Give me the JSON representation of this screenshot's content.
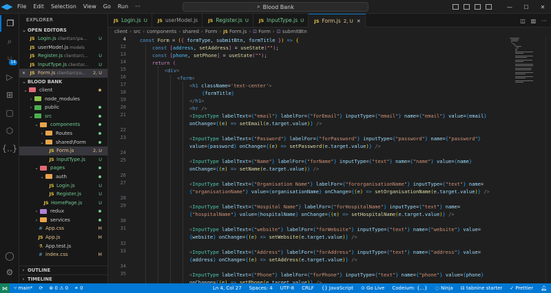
{
  "titlebar": {
    "menu": [
      "File",
      "Edit",
      "Selection",
      "View",
      "Go",
      "Run",
      "···"
    ],
    "search": "Blood Bank"
  },
  "sidebar": {
    "title": "EXPLORER",
    "open_editors_label": "OPEN EDITORS",
    "open_editors": [
      {
        "name": "Login.js",
        "desc": "client\\src\\pa...",
        "status": "U",
        "icon": "JS"
      },
      {
        "name": "userModel.js",
        "desc": "models",
        "status": "",
        "icon": "JS"
      },
      {
        "name": "Register.js",
        "desc": "client\\src\\...",
        "status": "U",
        "icon": "JS"
      },
      {
        "name": "InputType.js",
        "desc": "client\\sr...",
        "status": "U",
        "icon": "JS"
      },
      {
        "name": "Form.js",
        "desc": "client\\src\\co...",
        "status": "2, U",
        "icon": "JS",
        "close": "✕"
      }
    ],
    "project_label": "BLOOD BANK",
    "tree": [
      {
        "name": "client",
        "kind": "folder",
        "depth": 0,
        "open": true,
        "color": "#e06c75"
      },
      {
        "name": "node_modules",
        "kind": "folder",
        "depth": 1,
        "open": false,
        "color": "#8bc34a"
      },
      {
        "name": "public",
        "kind": "folder",
        "depth": 1,
        "open": false,
        "color": "#4caf50"
      },
      {
        "name": "src",
        "kind": "folder",
        "depth": 1,
        "open": true,
        "color": "#4caf50"
      },
      {
        "name": "components",
        "kind": "folder",
        "depth": 2,
        "open": true,
        "color": "#e8a54b"
      },
      {
        "name": "Routes",
        "kind": "folder",
        "depth": 3,
        "open": false,
        "color": "#e8a54b"
      },
      {
        "name": "shared\\Form",
        "kind": "folder",
        "depth": 3,
        "open": true,
        "color": "#e8a54b"
      },
      {
        "name": "Form.js",
        "kind": "js",
        "depth": 4,
        "status": "2, U",
        "selected": true
      },
      {
        "name": "InputType.js",
        "kind": "js",
        "depth": 4,
        "status": "U"
      },
      {
        "name": "pages",
        "kind": "folder",
        "depth": 2,
        "open": true,
        "color": "#e06c75"
      },
      {
        "name": "auth",
        "kind": "folder",
        "depth": 3,
        "open": true,
        "color": "#e8a54b"
      },
      {
        "name": "Login.js",
        "kind": "js",
        "depth": 4,
        "status": "U"
      },
      {
        "name": "Register.js",
        "kind": "js",
        "depth": 4,
        "status": "U"
      },
      {
        "name": "HomePage.js",
        "kind": "js",
        "depth": 3,
        "status": "U"
      },
      {
        "name": "redux",
        "kind": "folder",
        "depth": 2,
        "open": false,
        "color": "#b180d7"
      },
      {
        "name": "services",
        "kind": "folder",
        "depth": 2,
        "open": false,
        "color": "#e8a54b"
      },
      {
        "name": "App.css",
        "kind": "css",
        "depth": 2,
        "status": "M"
      },
      {
        "name": "App.js",
        "kind": "js",
        "depth": 2,
        "status": "M"
      },
      {
        "name": "App.test.js",
        "kind": "test",
        "depth": 2,
        "status": ""
      },
      {
        "name": "index.css",
        "kind": "css",
        "depth": 2,
        "status": "M"
      }
    ],
    "outline_label": "OUTLINE",
    "timeline_label": "TIMELINE"
  },
  "activity": {
    "source_control_badge": "14"
  },
  "tabs": [
    {
      "label": "Login.js",
      "status": "U",
      "active": false
    },
    {
      "label": "userModel.js",
      "status": "",
      "active": false
    },
    {
      "label": "Register.js",
      "status": "U",
      "active": false
    },
    {
      "label": "InputType.js",
      "status": "U",
      "active": false
    },
    {
      "label": "Form.js",
      "status": "2, U",
      "active": true
    }
  ],
  "breadcrumb": [
    "client",
    "src",
    "components",
    "shared",
    "Form",
    "Form.js",
    "Form",
    "submitBtn"
  ],
  "editor": {
    "lines": [
      {
        "n": "4",
        "html": "<span class=\"kw\">const</span> <span class=\"fn\">Form</span> = <span class=\"br1\">(</span><span class=\"br2\">{</span> <span class=\"var\">formType</span>, <span class=\"var\">submitBtn</span>, <span class=\"var\">formTitle</span> <span class=\"br2\">}</span><span class=\"br1\">)</span> <span class=\"kw\">=></span> <span class=\"br1\">{</span>",
        "indent": 0
      },
      {
        "n": "12",
        "html": "<span class=\"kw\">const</span> <span class=\"br2\">[</span><span class=\"cn\">address</span>, <span class=\"fn\">setAddress</span><span class=\"br2\">]</span> = <span class=\"fn\">useState</span><span class=\"br2\">(</span><span class=\"str\">\"\"</span><span class=\"br2\">)</span>;",
        "indent": 1
      },
      {
        "n": "13",
        "html": "<span class=\"kw\">const</span> <span class=\"br2\">[</span><span class=\"cn\">phone</span>, <span class=\"fn\">setPhone</span><span class=\"br2\">]</span> = <span class=\"fn\">useState</span><span class=\"br2\">(</span><span class=\"str\">\"\"</span><span class=\"br2\">)</span>;",
        "indent": 1
      },
      {
        "n": "14",
        "html": "<span class=\"kw2\">return</span> <span class=\"br2\">(</span>",
        "indent": 1
      },
      {
        "n": "15",
        "html": "<span class=\"tgb\">&lt;</span><span class=\"tag\">div</span><span class=\"tgb\">&gt;</span>",
        "indent": 2
      },
      {
        "n": "16",
        "html": "<span class=\"tgb\">&lt;</span><span class=\"tag\">form</span><span class=\"tgb\">&gt;</span>",
        "indent": 3
      },
      {
        "n": "17",
        "html": "<span class=\"tgb\">&lt;</span><span class=\"tag\">h1</span> <span class=\"attr\">className</span>=<span class=\"str\">'text-center'</span><span class=\"tgb\">&gt;</span>",
        "indent": 4
      },
      {
        "n": "18",
        "html": "<span class=\"br3\">{</span><span class=\"var\">formTitle</span><span class=\"br3\">}</span>",
        "indent": 5
      },
      {
        "n": "19",
        "html": "<span class=\"tgb\">&lt;/</span><span class=\"tag\">h1</span><span class=\"tgb\">&gt;</span>",
        "indent": 4
      },
      {
        "n": "20",
        "html": "<span class=\"tgb\">&lt;</span><span class=\"tag\">hr</span> <span class=\"tgb\">/&gt;</span>",
        "indent": 4
      },
      {
        "n": "21",
        "html": "<span class=\"tgb\">&lt;</span><span class=\"cmp\">InputType</span> <span class=\"attr\">labelText</span>=<span class=\"br3\">{</span><span class=\"str\">\"email\"</span><span class=\"br3\">}</span> <span class=\"attr\">labelFor</span>=<span class=\"br3\">{</span><span class=\"str\">\"forEmail\"</span><span class=\"br3\">}</span> <span class=\"attr\">inputType</span>=<span class=\"br3\">{</span><span class=\"str\">\"email\"</span><span class=\"br3\">}</span> <span class=\"attr\">name</span>=<span class=\"br3\">{</span><span class=\"str\">\"email\"</span><span class=\"br3\">}</span> <span class=\"attr\">value</span>=<span class=\"br3\">{</span><span class=\"var\">email</span><span class=\"br3\">}</span>",
        "indent": 4
      },
      {
        "n": "",
        "html": "<span class=\"attr\">onChange</span>=<span class=\"br3\">{</span><span class=\"br1\">(</span><span class=\"var\">e</span><span class=\"br1\">)</span> <span class=\"kw\">=></span> <span class=\"fn\">setEmail</span><span class=\"br1\">(</span><span class=\"var\">e</span>.<span class=\"var\">target</span>.<span class=\"var\">value</span><span class=\"br1\">)</span><span class=\"br3\">}</span> <span class=\"tgb\">/&gt;</span>",
        "indent": 4
      },
      {
        "n": "22",
        "html": "",
        "indent": 4
      },
      {
        "n": "23",
        "html": "<span class=\"tgb\">&lt;</span><span class=\"cmp\">InputType</span> <span class=\"attr\">labelText</span>=<span class=\"br3\">{</span><span class=\"str\">\"Password\"</span><span class=\"br3\">}</span> <span class=\"attr\">labelFor</span>=<span class=\"br3\">{</span><span class=\"str\">\"forPassword\"</span><span class=\"br3\">}</span> <span class=\"attr\">inputType</span>=<span class=\"br3\">{</span><span class=\"str\">\"password\"</span><span class=\"br3\">}</span> <span class=\"attr\">name</span>=<span class=\"br3\">{</span><span class=\"str\">\"password\"</span><span class=\"br3\">}</span>",
        "indent": 4
      },
      {
        "n": "",
        "html": "<span class=\"attr\">value</span>=<span class=\"br3\">{</span><span class=\"var\">password</span><span class=\"br3\">}</span> <span class=\"attr\">onChange</span>=<span class=\"br3\">{</span><span class=\"br1\">(</span><span class=\"var\">e</span><span class=\"br1\">)</span> <span class=\"kw\">=></span> <span class=\"fn\">setPassword</span><span class=\"br1\">(</span><span class=\"var\">e</span>.<span class=\"var\">target</span>.<span class=\"var\">value</span><span class=\"br1\">)</span><span class=\"br3\">}</span> <span class=\"tgb\">/&gt;</span>",
        "indent": 4
      },
      {
        "n": "24",
        "html": "",
        "indent": 4
      },
      {
        "n": "25",
        "html": "<span class=\"tgb\">&lt;</span><span class=\"cmp\">InputType</span> <span class=\"attr\">labelText</span>=<span class=\"br3\">{</span><span class=\"str\">\"Name\"</span><span class=\"br3\">}</span> <span class=\"attr\">labelFor</span>=<span class=\"br3\">{</span><span class=\"str\">\"forName\"</span><span class=\"br3\">}</span> <span class=\"attr\">inputType</span>=<span class=\"br3\">{</span><span class=\"str\">\"text\"</span><span class=\"br3\">}</span> <span class=\"attr\">name</span>=<span class=\"br3\">{</span><span class=\"str\">\"name\"</span><span class=\"br3\">}</span> <span class=\"attr\">value</span>=<span class=\"br3\">{</span><span class=\"var\">name</span><span class=\"br3\">}</span>",
        "indent": 4
      },
      {
        "n": "",
        "html": "<span class=\"attr\">onChange</span>=<span class=\"br3\">{</span><span class=\"br1\">(</span><span class=\"var\">e</span><span class=\"br1\">)</span> <span class=\"kw\">=></span> <span class=\"fn\">setName</span><span class=\"br1\">(</span><span class=\"var\">e</span>.<span class=\"var\">target</span>.<span class=\"var\">value</span><span class=\"br1\">)</span><span class=\"br3\">}</span> <span class=\"tgb\">/&gt;</span>",
        "indent": 4
      },
      {
        "n": "26",
        "html": "",
        "indent": 4
      },
      {
        "n": "27",
        "html": "<span class=\"tgb\">&lt;</span><span class=\"cmp\">InputType</span> <span class=\"attr\">labelText</span>=<span class=\"br3\">{</span><span class=\"str\">\"Organisation Name\"</span><span class=\"br3\">}</span> <span class=\"attr\">labelFor</span>=<span class=\"br3\">{</span><span class=\"str\">\"fororganisationName\"</span><span class=\"br3\">}</span> <span class=\"attr\">inputType</span>=<span class=\"br3\">{</span><span class=\"str\">\"text\"</span><span class=\"br3\">}</span> <span class=\"attr\">name</span>=",
        "indent": 4
      },
      {
        "n": "",
        "html": "<span class=\"br3\">{</span><span class=\"str\">\"organisationName\"</span><span class=\"br3\">}</span> <span class=\"attr\">value</span>=<span class=\"br3\">{</span><span class=\"var\">organisationName</span><span class=\"br3\">}</span> <span class=\"attr\">onChange</span>=<span class=\"br3\">{</span><span class=\"br1\">(</span><span class=\"var\">e</span><span class=\"br1\">)</span> <span class=\"kw\">=></span> <span class=\"fn\">setOrganisationName</span><span class=\"br1\">(</span><span class=\"var\">e</span>.<span class=\"var\">target</span>.<span class=\"var\">value</span><span class=\"br1\">)</span><span class=\"br3\">}</span> <span class=\"tgb\">/&gt;</span>",
        "indent": 4
      },
      {
        "n": "28",
        "html": "",
        "indent": 4
      },
      {
        "n": "29",
        "html": "<span class=\"tgb\">&lt;</span><span class=\"cmp\">InputType</span> <span class=\"attr\">labelText</span>=<span class=\"br3\">{</span><span class=\"str\">\"Hospital Name\"</span><span class=\"br3\">}</span> <span class=\"attr\">labelFor</span>=<span class=\"br3\">{</span><span class=\"str\">\"forHospitalName\"</span><span class=\"br3\">}</span> <span class=\"attr\">inputType</span>=<span class=\"br3\">{</span><span class=\"str\">\"text\"</span><span class=\"br3\">}</span> <span class=\"attr\">name</span>=",
        "indent": 4
      },
      {
        "n": "",
        "html": "<span class=\"br3\">{</span><span class=\"str\">\"hospitalName\"</span><span class=\"br3\">}</span> <span class=\"attr\">value</span>=<span class=\"br3\">{</span><span class=\"var\">hospitalName</span><span class=\"br3\">}</span> <span class=\"attr\">onChange</span>=<span class=\"br3\">{</span><span class=\"br1\">(</span><span class=\"var\">e</span><span class=\"br1\">)</span> <span class=\"kw\">=></span> <span class=\"fn\">setHospitalName</span><span class=\"br1\">(</span><span class=\"var\">e</span>.<span class=\"var\">target</span>.<span class=\"var\">value</span><span class=\"br1\">)</span><span class=\"br3\">}</span> <span class=\"tgb\">/&gt;</span>",
        "indent": 4
      },
      {
        "n": "30",
        "html": "",
        "indent": 4
      },
      {
        "n": "31",
        "html": "<span class=\"tgb\">&lt;</span><span class=\"cmp\">InputType</span> <span class=\"attr\">labelText</span>=<span class=\"br3\">{</span><span class=\"str\">\"website\"</span><span class=\"br3\">}</span> <span class=\"attr\">labelFor</span>=<span class=\"br3\">{</span><span class=\"str\">\"forWebsite\"</span><span class=\"br3\">}</span> <span class=\"attr\">inputType</span>=<span class=\"br3\">{</span><span class=\"str\">\"text\"</span><span class=\"br3\">}</span> <span class=\"attr\">name</span>=<span class=\"br3\">{</span><span class=\"str\">\"website\"</span><span class=\"br3\">}</span> <span class=\"attr\">value</span>=",
        "indent": 4
      },
      {
        "n": "",
        "html": "<span class=\"br3\">{</span><span class=\"var\">website</span><span class=\"br3\">}</span> <span class=\"attr\">onChange</span>=<span class=\"br3\">{</span><span class=\"br1\">(</span><span class=\"var\">e</span><span class=\"br1\">)</span> <span class=\"kw\">=></span> <span class=\"fn\">setWebsite</span><span class=\"br1\">(</span><span class=\"var\">e</span>.<span class=\"var\">target</span>.<span class=\"var\">value</span><span class=\"br1\">)</span><span class=\"br3\">}</span> <span class=\"tgb\">/&gt;</span>",
        "indent": 4
      },
      {
        "n": "32",
        "html": "",
        "indent": 4
      },
      {
        "n": "33",
        "html": "<span class=\"tgb\">&lt;</span><span class=\"cmp\">InputType</span> <span class=\"attr\">labelText</span>=<span class=\"br3\">{</span><span class=\"str\">\"Address\"</span><span class=\"br3\">}</span> <span class=\"attr\">labelFor</span>=<span class=\"br3\">{</span><span class=\"str\">\"forAddress\"</span><span class=\"br3\">}</span> <span class=\"attr\">inputType</span>=<span class=\"br3\">{</span><span class=\"str\">\"text\"</span><span class=\"br3\">}</span> <span class=\"attr\">name</span>=<span class=\"br3\">{</span><span class=\"str\">\"address\"</span><span class=\"br3\">}</span> <span class=\"attr\">value</span>=",
        "indent": 4
      },
      {
        "n": "",
        "html": "<span class=\"br3\">{</span><span class=\"var\">address</span><span class=\"br3\">}</span> <span class=\"attr\">onChange</span>=<span class=\"br3\">{</span><span class=\"br1\">(</span><span class=\"var\">e</span><span class=\"br1\">)</span> <span class=\"kw\">=></span> <span class=\"fn\">setAddress</span><span class=\"br1\">(</span><span class=\"var\">e</span>.<span class=\"var\">target</span>.<span class=\"var\">value</span><span class=\"br1\">)</span><span class=\"br3\">}</span> <span class=\"tgb\">/&gt;</span>",
        "indent": 4
      },
      {
        "n": "34",
        "html": "",
        "indent": 4
      },
      {
        "n": "35",
        "html": "<span class=\"tgb\">&lt;</span><span class=\"cmp\">InputType</span> <span class=\"attr\">labelText</span>=<span class=\"br3\">{</span><span class=\"str\">\"Phone\"</span><span class=\"br3\">}</span> <span class=\"attr\">labelFor</span>=<span class=\"br3\">{</span><span class=\"str\">\"forPhone\"</span><span class=\"br3\">}</span> <span class=\"attr\">inputType</span>=<span class=\"br3\">{</span><span class=\"str\">\"text\"</span><span class=\"br3\">}</span> <span class=\"attr\">name</span>=<span class=\"br3\">{</span><span class=\"str\">\"phone\"</span><span class=\"br3\">}</span> <span class=\"attr\">value</span>=<span class=\"br3\">{</span><span class=\"var\">phone</span><span class=\"br3\">}</span>",
        "indent": 4
      },
      {
        "n": "",
        "html": "<span class=\"attr\">onChange</span>=<span class=\"br3\">{</span><span class=\"br1\">(</span><span class=\"var\">e</span><span class=\"br1\">)</span> <span class=\"kw\">=></span> <span class=\"fn\">setPhone</span><span class=\"br1\">(</span><span class=\"var\">e</span>.<span class=\"var\">target</span>.<span class=\"var\">value</span><span class=\"br1\">)</span><span class=\"br3\">}</span> <span class=\"tgb\">/&gt;</span>",
        "indent": 4
      }
    ]
  },
  "statusbar": {
    "branch": "main*",
    "sync": "⟳",
    "errors": "⊗ 0 ⚠ 0",
    "ports": "⚭ 0",
    "position": "Ln 4, Col 27",
    "spaces": "Spaces: 4",
    "encoding": "UTF-8",
    "eol": "CRLF",
    "language": "{} JavaScript",
    "golive": "Go Live",
    "codeium": "Codeium: {...}",
    "ninja": "Ninja",
    "tabnine": "tabnine starter",
    "prettier": "✓ Prettier"
  },
  "colors": {
    "accent": "#0078d4",
    "untracked": "#73c991",
    "modified": "#e2c08d"
  }
}
